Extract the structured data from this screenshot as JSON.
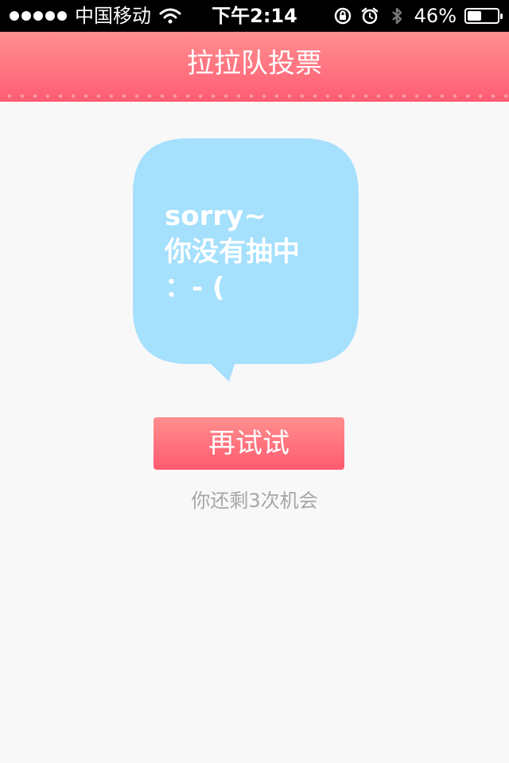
{
  "status_bar": {
    "carrier": "中国移动",
    "time": "下午2:14",
    "battery": "46%",
    "battery_level": 0.46
  },
  "nav": {
    "title": "拉拉队投票"
  },
  "result": {
    "line1": "sorry~",
    "line2": "你没有抽中",
    "line3": "：- ("
  },
  "actions": {
    "retry_label": "再试试"
  },
  "chances": {
    "text": "你还剩3次机会"
  },
  "colors": {
    "accent": "#ff6174",
    "bubble": "#a5e0fd"
  }
}
